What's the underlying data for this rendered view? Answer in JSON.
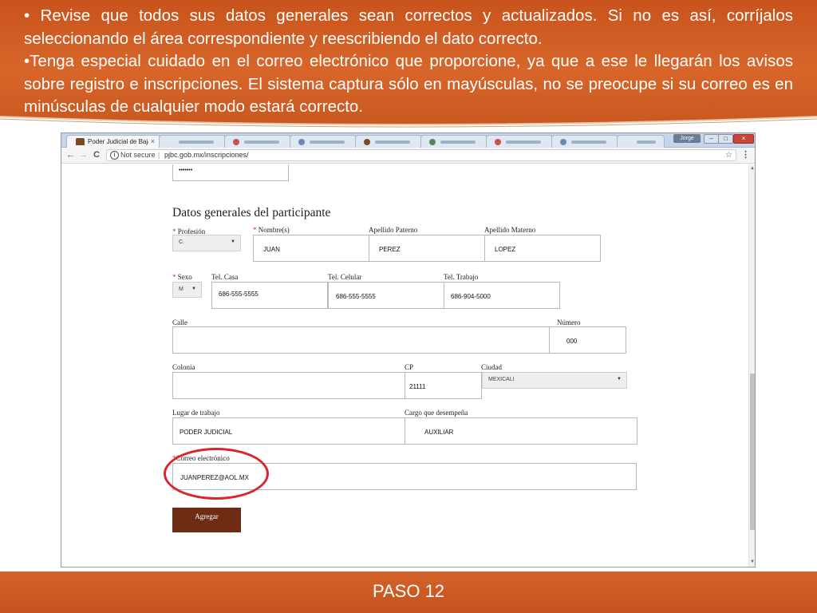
{
  "slide": {
    "bullet_1": "• Revise que todos sus datos generales sean correctos y actualizados. Si no es así, corríjalos seleccionando el área correspondiente y reescribiendo el dato correcto.",
    "bullet_2": "•Tenga especial cuidado en el correo electrónico que proporcione, ya que a ese le llegarán los avisos sobre registro e inscripciones. El sistema captura sólo en mayúsculas, no se preocupe si su correo es en minúsculas de cualquier modo estará correcto.",
    "footer": "PASO 12",
    "accent_color": "#d05c24",
    "highlight_color": "#d8262b"
  },
  "browser": {
    "active_tab": "Poder Judicial de Baja Ca",
    "tab_close": "×",
    "user_badge": "Jorge",
    "window_buttons": {
      "minimize": "–",
      "maximize": "□",
      "close": "×"
    },
    "nav": {
      "back": "←",
      "forward": "→",
      "reload": "C"
    },
    "security_label": "Not secure",
    "url": "pjbc.gob.mx/inscripciones/",
    "bookmark_icon": "☆",
    "menu_icon": "⋮"
  },
  "form": {
    "password_mask": "•••••••",
    "section_title": "Datos generales del participante",
    "required_mark": "*",
    "profesion": {
      "label": "Profesión",
      "value": "C."
    },
    "nombre": {
      "label": "Nombre(s)",
      "value": "JUAN"
    },
    "apellido_paterno": {
      "label": "Apellido Paterno",
      "value": "PEREZ"
    },
    "apellido_materno": {
      "label": "Apellido Materno",
      "value": "LOPEZ"
    },
    "sexo": {
      "label": "Sexo",
      "value": "M"
    },
    "tel_casa": {
      "label": "Tel. Casa",
      "value": "686-555-5555"
    },
    "tel_celular": {
      "label": "Tel. Celular",
      "value": "686-555-5555"
    },
    "tel_trabajo": {
      "label": "Tel. Trabajo",
      "value": "686-904-5000"
    },
    "calle": {
      "label": "Calle",
      "value": ""
    },
    "numero": {
      "label": "Número",
      "value": "000"
    },
    "colonia": {
      "label": "Colonia",
      "value": ""
    },
    "cp": {
      "label": "CP",
      "value": "21111"
    },
    "ciudad": {
      "label": "Ciudad",
      "value": "MEXICALI"
    },
    "lugar_trabajo": {
      "label": "Lugar de trabajo",
      "value": "PODER JUDICIAL"
    },
    "cargo": {
      "label": "Cargo que desempeña",
      "value": "AUXILIAR"
    },
    "correo": {
      "label": "Correo electrónico",
      "value": "JUANPEREZ@AOL.MX"
    },
    "submit_label": "Agregar"
  }
}
